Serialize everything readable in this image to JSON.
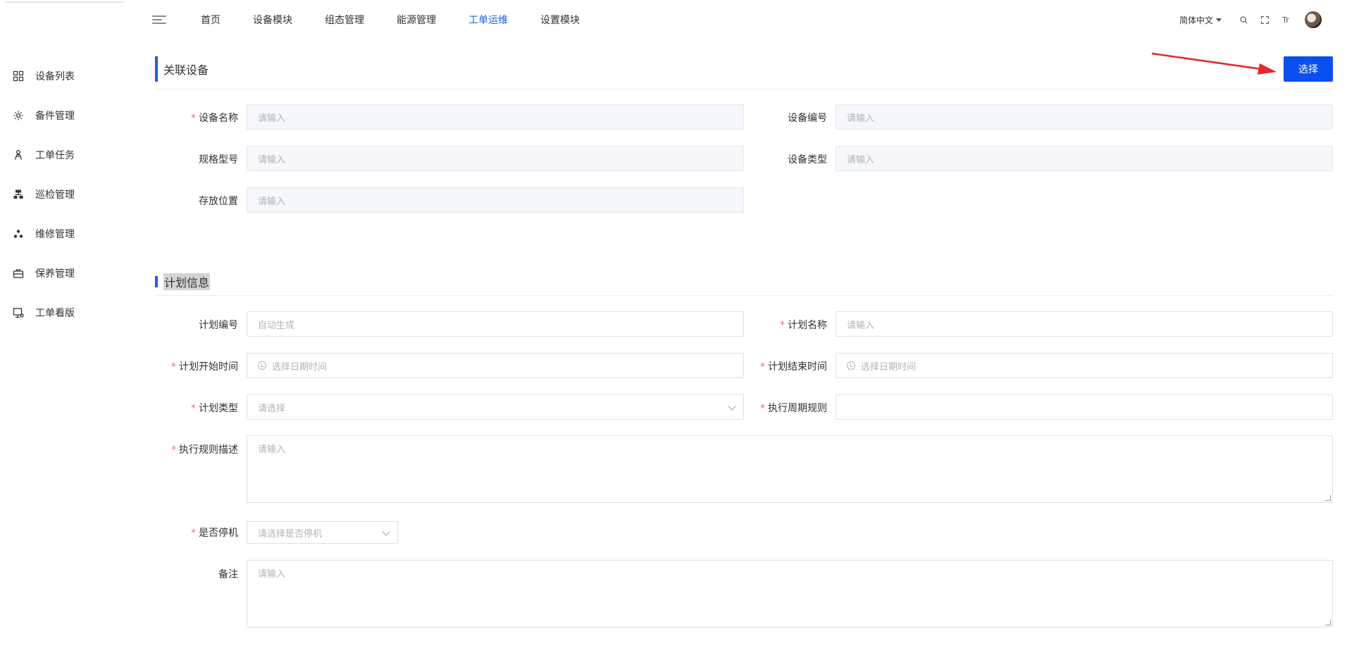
{
  "sidebar": {
    "items": [
      {
        "label": "设备列表",
        "icon": "grid-icon"
      },
      {
        "label": "备件管理",
        "icon": "gear-icon"
      },
      {
        "label": "工单任务",
        "icon": "person-icon"
      },
      {
        "label": "巡检管理",
        "icon": "hierarchy-icon"
      },
      {
        "label": "维修管理",
        "icon": "cluster-icon"
      },
      {
        "label": "保养管理",
        "icon": "toolbox-icon"
      },
      {
        "label": "工单看版",
        "icon": "monitor-icon"
      }
    ]
  },
  "header": {
    "nav": [
      {
        "label": "首页",
        "active": false
      },
      {
        "label": "设备模块",
        "active": false
      },
      {
        "label": "组态管理",
        "active": false
      },
      {
        "label": "能源管理",
        "active": false
      },
      {
        "label": "工单运维",
        "active": true
      },
      {
        "label": "设置模块",
        "active": false
      }
    ],
    "language": "简体中文",
    "font_size_icon_text": "Tr"
  },
  "device_section": {
    "title": "关联设备",
    "select_button": "选择",
    "fields": {
      "name": {
        "label": "设备名称",
        "placeholder": "请输入",
        "required": true
      },
      "code": {
        "label": "设备编号",
        "placeholder": "请输入"
      },
      "spec": {
        "label": "规格型号",
        "placeholder": "请输入"
      },
      "type": {
        "label": "设备类型",
        "placeholder": "请输入"
      },
      "location": {
        "label": "存放位置",
        "placeholder": "请输入"
      }
    }
  },
  "plan_section": {
    "title": "计划信息",
    "fields": {
      "plan_code": {
        "label": "计划编号",
        "placeholder": "自动生成"
      },
      "plan_name": {
        "label": "计划名称",
        "placeholder": "请输入",
        "required": true
      },
      "start_time": {
        "label": "计划开始时间",
        "placeholder": "选择日期时间",
        "required": true
      },
      "end_time": {
        "label": "计划结束时间",
        "placeholder": "选择日期时间",
        "required": true
      },
      "plan_type": {
        "label": "计划类型",
        "placeholder": "请选择",
        "required": true
      },
      "cycle_rule": {
        "label": "执行周期规则",
        "placeholder": "",
        "required": true
      },
      "rule_desc": {
        "label": "执行规则描述",
        "placeholder": "请输入",
        "required": true
      },
      "shutdown": {
        "label": "是否停机",
        "placeholder": "请选择是否停机",
        "required": true
      },
      "remark": {
        "label": "备注",
        "placeholder": "请输入"
      }
    }
  },
  "colors": {
    "accent": "#1f5fd9",
    "primary_button": "#0b4ff0",
    "required": "#f56c6c",
    "annotation_arrow": "#e8262b"
  }
}
